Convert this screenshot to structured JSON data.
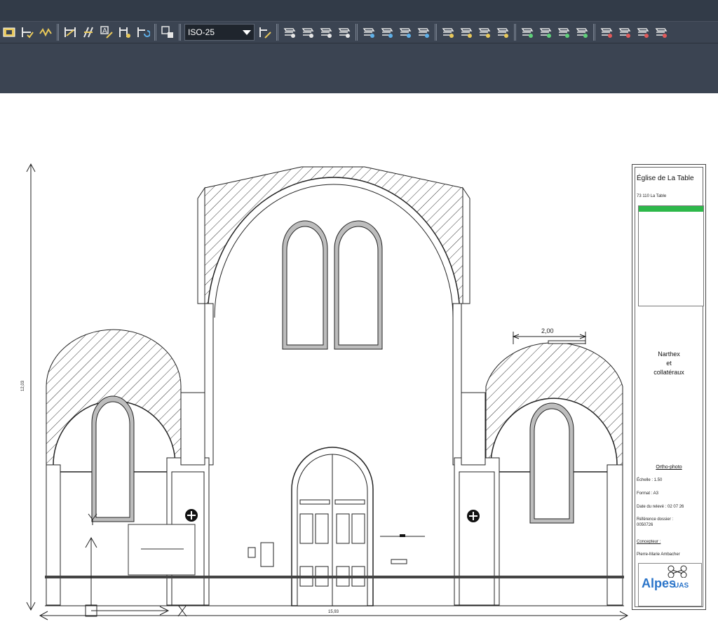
{
  "toolbar": {
    "dim_style_value": "ISO-25",
    "buttons_left": [
      "quick-dimension-icon",
      "dimension-continue-icon",
      "dimension-break-icon",
      "dimension-adjust-space-icon",
      "dimension-jogged-icon",
      "dimension-text-edit-icon",
      "dimension-oblique-icon",
      "dimension-update-icon",
      "inspect-dimension-icon"
    ],
    "buttons_right": [
      "layer-properties-icon",
      "layer-states-icon",
      "layer-isolate-icon",
      "layer-unisolate-icon",
      "layer-match-icon",
      "layer-previous-icon",
      "layer-off-icon",
      "layer-on-icon",
      "layer-freeze-icon",
      "layer-thaw-icon",
      "layer-lock-icon",
      "layer-unlock-icon",
      "layer-walk-icon",
      "layer-merge-icon",
      "layer-delete-icon",
      "layer-color-icon",
      "layer-lineweight-icon",
      "layer-plot-icon",
      "layer-transparency-icon",
      "layer-lock-toggle-icon"
    ]
  },
  "drawing": {
    "scale_bar_label": "2,00",
    "height_dimension": "12,03",
    "width_dimension": "15,93"
  },
  "title_block": {
    "title": "Église de La Table",
    "address": "73 110 La Table",
    "view_title_line1": "Narthex",
    "view_title_line2": "et",
    "view_title_line3": "collatéraux",
    "ortho_label": "Ortho-photo",
    "scale": "Échelle : 1.50",
    "format": "Format : A3",
    "survey_date": "Date du relevé : 02 07 26",
    "reference_label": "Référence dossier :",
    "reference_value": "0050726",
    "designer_label": "Concepteur :",
    "designer_name": "Pierre-Marie Ambacher",
    "logo_text_big": "Alpes",
    "logo_text_small": "UAS"
  }
}
